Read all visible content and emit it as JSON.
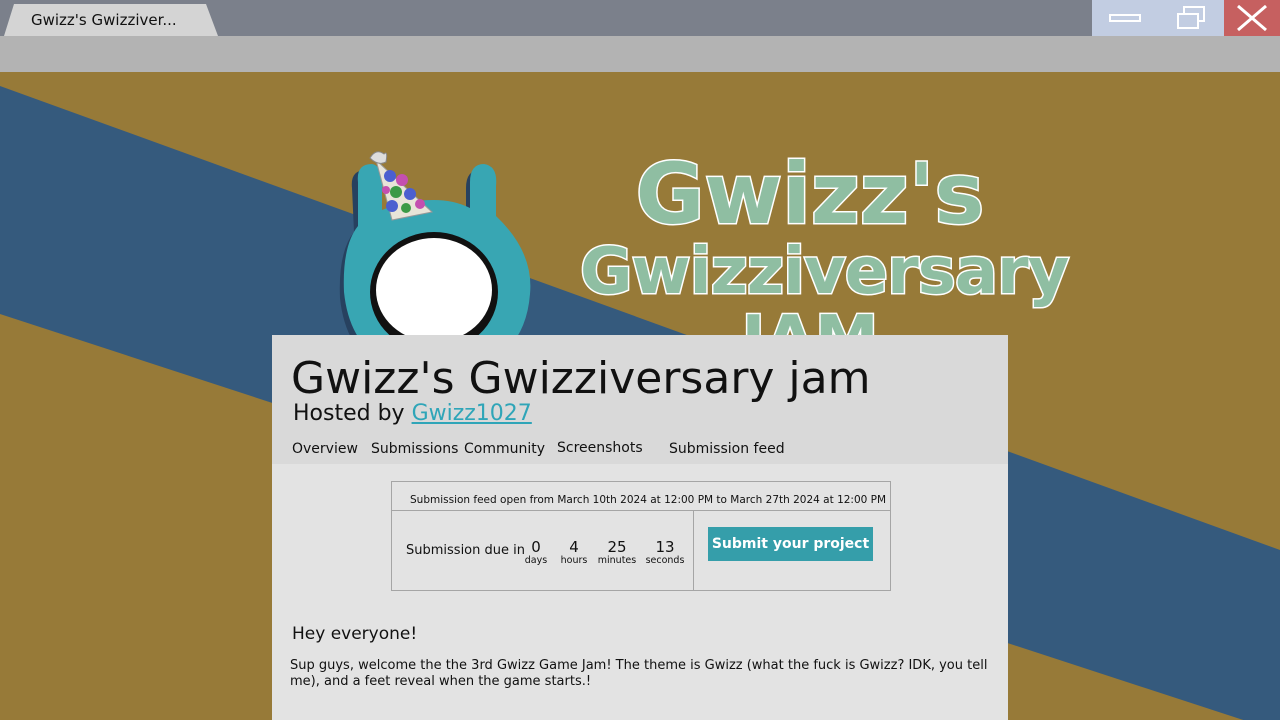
{
  "window": {
    "tab_title": "Gwizz's Gwizziver...",
    "minimize_icon": "minimize-icon",
    "maximize_icon": "restore-icon",
    "close_icon": "close-icon"
  },
  "banner": {
    "line1": "Gwizz's",
    "line2": "Gwizziversary",
    "line3": "JAM",
    "mascot_icon": "party-hat-mascot-icon"
  },
  "jam": {
    "title": "Gwizz's Gwizziversary jam",
    "hosted_prefix": "Hosted by ",
    "host": "Gwizz1027"
  },
  "nav": {
    "overview": "Overview",
    "submissions": "Submissions",
    "community": "Community",
    "screenshots": "Screenshots",
    "submission_feed": "Submission feed"
  },
  "submission": {
    "open_text": "Submission feed open from March 10th 2024 at 12:00 PM to March 27th 2024 at 12:00 PM",
    "due_label": "Submission due in",
    "countdown": [
      {
        "value": "0",
        "unit": "days"
      },
      {
        "value": "4",
        "unit": "hours"
      },
      {
        "value": "25",
        "unit": "minutes"
      },
      {
        "value": "13",
        "unit": "seconds"
      }
    ],
    "submit_label": "Submit your project"
  },
  "content": {
    "heading": "Hey everyone!",
    "body": "Sup guys, welcome the the 3rd Gwizz Game Jam! The theme is Gwizz (what the fuck is Gwizz? IDK, you tell me), and a feet reveal when the game starts.!"
  },
  "colors": {
    "background": "#977a38",
    "stripe": "#355a7d",
    "accent": "#359eaa",
    "title_text": "#8fbea2",
    "close": "#c66060"
  }
}
